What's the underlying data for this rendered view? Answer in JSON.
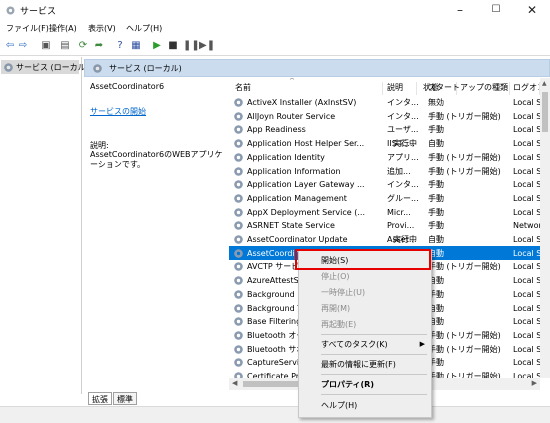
{
  "window": {
    "title": "サービス",
    "minimize": "–",
    "maximize": "☐",
    "close": "✕"
  },
  "menu": [
    "ファイル(F)",
    "操作(A)",
    "表示(V)",
    "ヘルプ(H)"
  ],
  "tree": {
    "selected": "サービス (ローカル)"
  },
  "panel_header": "サービス (ローカル)",
  "detail": {
    "service_name": "AssetCoordinator6",
    "start_link": "サービスの開始",
    "desc_label": "説明:",
    "desc_text": "AssetCoordinator6のWEBアプリケーションです。"
  },
  "table": {
    "columns": [
      "名前",
      "説明",
      "状態",
      "スタートアップの種類",
      "ログオン"
    ],
    "rows": [
      [
        "ActiveX Installer (AxInstSV)",
        "インタ...",
        "",
        "無効",
        "Local S"
      ],
      [
        "AllJoyn Router Service",
        "インタ...",
        "",
        "手動 (トリガー開始)",
        "Local S"
      ],
      [
        "App Readiness",
        "ユーザ...",
        "",
        "手動",
        "Local S"
      ],
      [
        "Application Host Helper Ser...",
        "IIS に...",
        "実行中",
        "自動",
        "Local S"
      ],
      [
        "Application Identity",
        "アプリ...",
        "",
        "手動 (トリガー開始)",
        "Local S"
      ],
      [
        "Application Information",
        "追加...",
        "",
        "手動 (トリガー開始)",
        "Local S"
      ],
      [
        "Application Layer Gateway ...",
        "インタ...",
        "",
        "手動",
        "Local S"
      ],
      [
        "Application Management",
        "グルー...",
        "",
        "手動",
        "Local S"
      ],
      [
        "AppX Deployment Service (...",
        "Micr...",
        "",
        "手動",
        "Local S"
      ],
      [
        "ASRNET State Service",
        "Provi...",
        "",
        "手動",
        "Networ"
      ],
      [
        "AssetCoordinator Update",
        "Asset...",
        "実行中",
        "自動",
        "Local S"
      ],
      [
        "AssetCoordinator6",
        "",
        "",
        "自動",
        "Local S"
      ],
      [
        "AVCTP サービス",
        "",
        "",
        "手動 (トリガー開始)",
        "Local S"
      ],
      [
        "AzureAttestService",
        "",
        "",
        "自動",
        "Local S"
      ],
      [
        "Background Intelligent...",
        "",
        "",
        "手動",
        "Local S"
      ],
      [
        "Background Tasks...",
        "",
        "",
        "自動",
        "Local S"
      ],
      [
        "Base Filtering Engine",
        "",
        "",
        "自動",
        "Local S"
      ],
      [
        "Bluetooth オーディオ...",
        "",
        "",
        "手動 (トリガー開始)",
        "Local S"
      ],
      [
        "Bluetooth サポート...",
        "",
        "",
        "手動 (トリガー開始)",
        "Local S"
      ],
      [
        "CaptureService",
        "",
        "",
        "手動",
        "Local S"
      ],
      [
        "Certificate Propagation",
        "",
        "",
        "手動 (トリガー開始)",
        "Local S"
      ]
    ]
  },
  "tabs": [
    "拡張",
    "標準"
  ],
  "context_menu": {
    "start": "開始(S)",
    "stop": "停止(O)",
    "pause": "一時停止(U)",
    "resume": "再開(M)",
    "restart": "再起動(E)",
    "all_tasks": "すべてのタスク(K)",
    "refresh": "最新の情報に更新(F)",
    "properties": "プロパティ(R)",
    "help": "ヘルプ(H)"
  }
}
